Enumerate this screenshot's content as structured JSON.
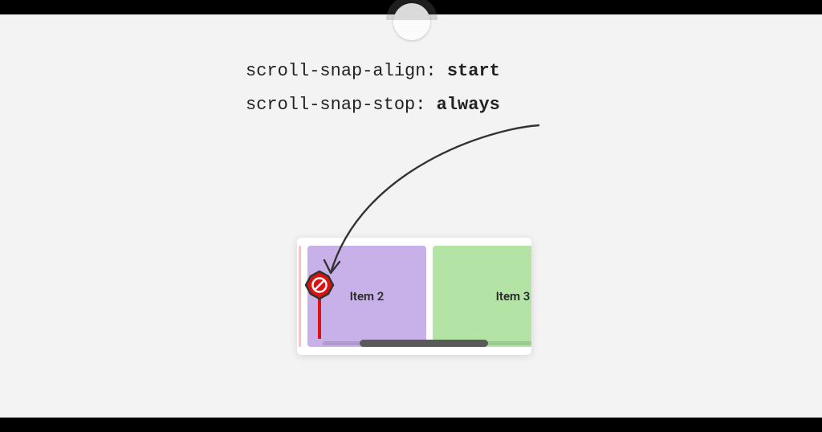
{
  "code": {
    "line1_prop": "scroll-snap-align: ",
    "line1_val": "start",
    "line2_prop": "scroll-snap-stop: ",
    "line2_val": "always"
  },
  "cards": {
    "item2": "Item 2",
    "item3": "Item 3"
  }
}
